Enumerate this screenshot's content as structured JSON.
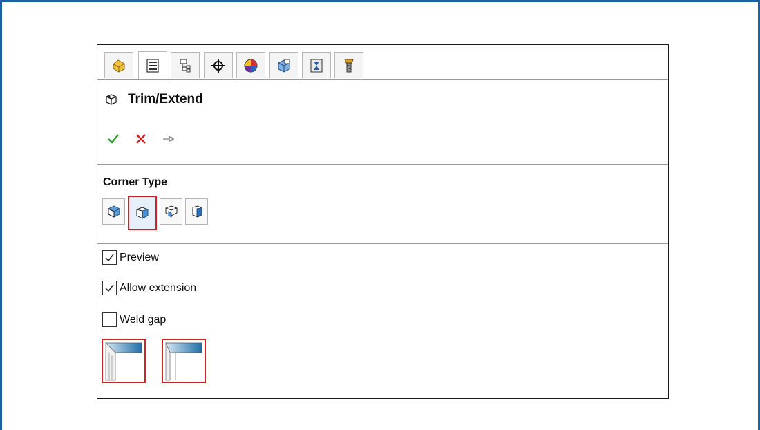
{
  "tabs": [
    {
      "icon": "feature-manager-icon"
    },
    {
      "icon": "property-manager-icon",
      "active": true
    },
    {
      "icon": "configuration-manager-icon"
    },
    {
      "icon": "dimxpert-icon"
    },
    {
      "icon": "display-manager-icon"
    },
    {
      "icon": "cam-feature-icon"
    },
    {
      "icon": "cam-operation-icon"
    },
    {
      "icon": "cam-tool-icon"
    }
  ],
  "title": "Trim/Extend",
  "actions": {
    "ok": "ok-check-icon",
    "cancel": "cancel-x-icon",
    "pin": "pushpin-icon"
  },
  "corner_type": {
    "label": "Corner Type",
    "options": [
      "end-trim",
      "end-miter",
      "end-butt1",
      "end-butt2"
    ],
    "selected_index": 1
  },
  "checkboxes": [
    {
      "label": "Preview",
      "checked": true
    },
    {
      "label": "Allow extension",
      "checked": true
    },
    {
      "label": "Weld gap",
      "checked": false
    }
  ],
  "colors": {
    "accent": "#1f5f9e",
    "highlight": "#d32020",
    "ok": "#2a9d2a",
    "cancel": "#d32020"
  }
}
